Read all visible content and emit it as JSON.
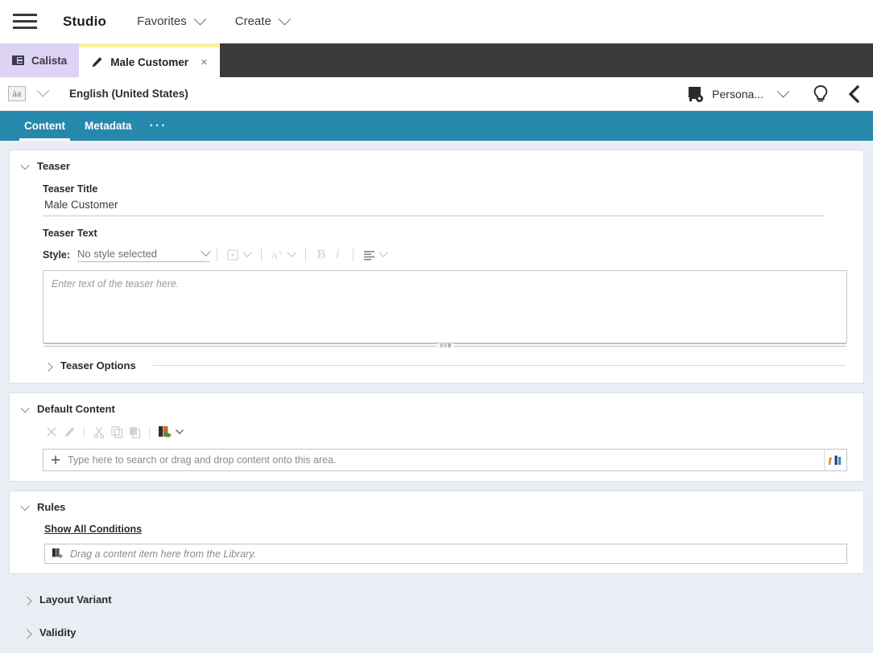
{
  "topbar": {
    "menu_icon": "hamburger-icon",
    "brand": "Studio",
    "menus": [
      {
        "label": "Favorites",
        "icon": "chevron-down-icon"
      },
      {
        "label": "Create",
        "icon": "chevron-down-icon"
      }
    ]
  },
  "tabs": [
    {
      "label": "Calista",
      "icon": "layout-icon",
      "active": false,
      "closable": false
    },
    {
      "label": "Male Customer",
      "icon": "pencil-icon",
      "active": true,
      "closable": true,
      "close_glyph": "×"
    }
  ],
  "langbar": {
    "lang_icon": "àa",
    "lang_icon_name": "language-icon",
    "language": "English (United States)",
    "persona_label": "Persona...",
    "persona_icon": "persona-settings-icon",
    "bulb_icon": "lightbulb-icon",
    "collapse_icon": "chevron-left-icon"
  },
  "content_tabs": [
    {
      "label": "Content",
      "selected": true
    },
    {
      "label": "Metadata",
      "selected": false
    },
    {
      "label": "···",
      "selected": false
    }
  ],
  "teaser": {
    "section_title": "Teaser",
    "expanded": true,
    "title_label": "Teaser Title",
    "title_value": "Male Customer",
    "text_label": "Teaser Text",
    "style_label": "Style:",
    "style_value": "No style selected",
    "toolbar": [
      {
        "name": "insert-object-button",
        "glyph": "■",
        "disabled": true
      },
      {
        "name": "insert-object-dropdown",
        "glyph": "chevron-down-icon",
        "disabled": true
      },
      {
        "name": "font-size-button",
        "glyph": "A",
        "disabled": true
      },
      {
        "name": "font-size-dropdown",
        "glyph": "chevron-down-icon",
        "disabled": true
      },
      {
        "name": "bold-button",
        "glyph": "B",
        "disabled": true
      },
      {
        "name": "italic-button",
        "glyph": "I",
        "disabled": true
      },
      {
        "name": "align-button",
        "glyph": "≡",
        "disabled": false
      },
      {
        "name": "align-dropdown",
        "glyph": "chevron-down-icon",
        "disabled": true
      }
    ],
    "editor_placeholder": "Enter text of the teaser here.",
    "options_label": "Teaser Options",
    "options_expanded": false
  },
  "default_content": {
    "section_title": "Default Content",
    "expanded": true,
    "toolbar": [
      {
        "name": "remove-button",
        "icon": "close-x-icon",
        "disabled": true
      },
      {
        "name": "edit-button",
        "icon": "pencil-icon",
        "disabled": true
      },
      {
        "name": "cut-button",
        "icon": "scissors-icon",
        "disabled": true
      },
      {
        "name": "copy-button",
        "icon": "copy-icon",
        "disabled": true
      },
      {
        "name": "paste-button",
        "icon": "paste-icon",
        "disabled": true
      },
      {
        "name": "add-content-button",
        "icon": "add-content-icon",
        "disabled": false
      },
      {
        "name": "add-content-dropdown",
        "icon": "chevron-down-icon",
        "disabled": false
      }
    ],
    "search_placeholder": "Type here to search or drag and drop content onto this area.",
    "add_glyph": "+",
    "library_icon": "library-icon"
  },
  "rules": {
    "section_title": "Rules",
    "expanded": true,
    "show_all_link": "Show All Conditions",
    "drop_placeholder": "Drag a content item here from the Library.",
    "drop_icon": "add-content-icon"
  },
  "collapsed_sections": [
    {
      "label": "Layout Variant",
      "expanded": false
    },
    {
      "label": "Validity",
      "expanded": false
    }
  ],
  "colors": {
    "accent_blue": "#2788ae",
    "tabstrip_dark": "#3b3b3b",
    "tab_lavender": "#ddd4f5",
    "tab_yellow": "#fbf0a0",
    "page_bg": "#e8eef4"
  }
}
